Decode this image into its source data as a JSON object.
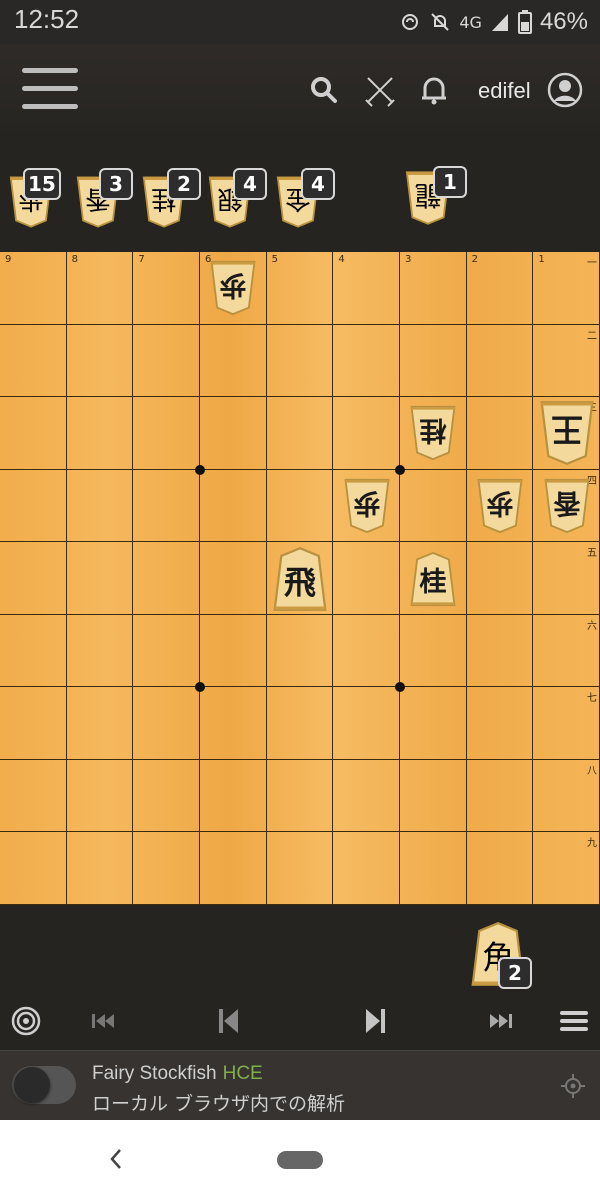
{
  "status": {
    "time": "12:52",
    "network": "4G",
    "battery": "46%"
  },
  "header": {
    "username": "edifel"
  },
  "files": [
    "9",
    "8",
    "7",
    "6",
    "5",
    "4",
    "3",
    "2",
    "1"
  ],
  "ranks": [
    "一",
    "二",
    "三",
    "四",
    "五",
    "六",
    "七",
    "八",
    "九"
  ],
  "opponent_hand": [
    {
      "name": "opponent-hand-pawn",
      "char": "歩",
      "count": "15"
    },
    {
      "name": "opponent-hand-lance",
      "char": "香",
      "count": "3"
    },
    {
      "name": "opponent-hand-knight",
      "char": "桂",
      "count": "2"
    },
    {
      "name": "opponent-hand-silver",
      "char": "銀",
      "count": "4"
    },
    {
      "name": "opponent-hand-gold",
      "char": "金",
      "count": "4"
    },
    {
      "name": "opponent-hand-promoted-rook",
      "char": "龍",
      "count": "1"
    }
  ],
  "player_hand": [
    {
      "name": "player-hand-bishop",
      "char": "角",
      "count": "2"
    }
  ],
  "board_pieces": [
    {
      "name": "piece-opponent-pawn-6-1",
      "char": "歩",
      "file": 6,
      "rank": 1,
      "side": "gote"
    },
    {
      "name": "piece-opponent-knight-3-3",
      "char": "桂",
      "file": 3,
      "rank": 3,
      "side": "gote"
    },
    {
      "name": "piece-opponent-king-1-3",
      "char": "王",
      "file": 1,
      "rank": 3,
      "side": "gote"
    },
    {
      "name": "piece-opponent-pawn-4-4",
      "char": "歩",
      "file": 4,
      "rank": 4,
      "side": "gote"
    },
    {
      "name": "piece-opponent-pawn-2-4",
      "char": "歩",
      "file": 2,
      "rank": 4,
      "side": "gote"
    },
    {
      "name": "piece-opponent-lance-1-4",
      "char": "香",
      "file": 1,
      "rank": 4,
      "side": "gote"
    },
    {
      "name": "piece-player-rook-5-5",
      "char": "飛",
      "file": 5,
      "rank": 5,
      "side": "sente"
    },
    {
      "name": "piece-player-knight-3-5",
      "char": "桂",
      "file": 3,
      "rank": 5,
      "side": "sente"
    }
  ],
  "engine": {
    "name": "Fairy Stockfish",
    "variant": "HCE",
    "description": "ローカル ブラウザ内での解析"
  }
}
